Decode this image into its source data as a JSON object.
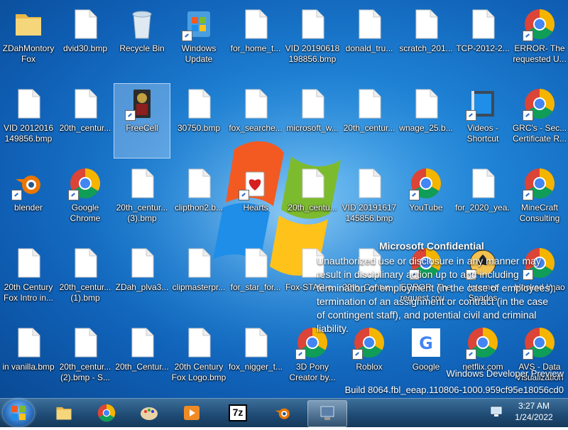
{
  "desktop": {
    "icons": [
      {
        "label": "ZDahMontory Fox",
        "icon": "folder-icon"
      },
      {
        "label": "dvid30.bmp",
        "icon": "bmp-file-icon"
      },
      {
        "label": "Recycle Bin",
        "icon": "recycle-bin-icon"
      },
      {
        "label": "Windows Update",
        "icon": "windows-update-icon"
      },
      {
        "label": "for_home_t...",
        "icon": "bmp-file-icon"
      },
      {
        "label": "VID 20190618 198856.bmp",
        "icon": "bmp-file-icon"
      },
      {
        "label": "donald_tru...",
        "icon": "bmp-file-icon"
      },
      {
        "label": "scratch_201...",
        "icon": "bmp-file-icon"
      },
      {
        "label": "TCP-2012-2...",
        "icon": "bmp-file-icon"
      },
      {
        "label": "ERROR- The requested U...",
        "icon": "chrome-icon"
      },
      {
        "label": "VID 2012016 149856.bmp",
        "icon": "bmp-file-icon"
      },
      {
        "label": "20th_centur...",
        "icon": "bmp-file-icon"
      },
      {
        "label": "FreeCell",
        "icon": "freecell-icon"
      },
      {
        "label": "30750.bmp",
        "icon": "bmp-file-icon"
      },
      {
        "label": "fox_searche...",
        "icon": "bmp-file-icon"
      },
      {
        "label": "microsoft_w...",
        "icon": "bmp-file-icon"
      },
      {
        "label": "20th_centur...",
        "icon": "bmp-file-icon"
      },
      {
        "label": "wnage_25.b...",
        "icon": "bmp-file-icon"
      },
      {
        "label": "Videos - Shortcut",
        "icon": "videos-icon"
      },
      {
        "label": "GRC's - Sec... Certificate R...",
        "icon": "chrome-icon"
      },
      {
        "label": "blender",
        "icon": "blender-icon"
      },
      {
        "label": "Google Chrome",
        "icon": "chrome-icon"
      },
      {
        "label": "20th_centur... (3).bmp",
        "icon": "bmp-file-icon"
      },
      {
        "label": "clipthon2.b...",
        "icon": "bmp-file-icon"
      },
      {
        "label": "Hearts",
        "icon": "hearts-icon"
      },
      {
        "label": "20th_centu...",
        "icon": "bmp-file-icon"
      },
      {
        "label": "VID 20191617 145856.bmp",
        "icon": "bmp-file-icon"
      },
      {
        "label": "YouTube",
        "icon": "chrome-icon"
      },
      {
        "label": "for_2020_yea...",
        "icon": "bmp-file-icon"
      },
      {
        "label": "MineCraft Consulting",
        "icon": "chrome-icon"
      },
      {
        "label": "20th Century Fox Intro in...",
        "icon": "bmp-file-icon"
      },
      {
        "label": "20th_centur... (1).bmp",
        "icon": "bmp-file-icon"
      },
      {
        "label": "ZDah_plva3...",
        "icon": "bmp-file-icon"
      },
      {
        "label": "clipmasterpr...",
        "icon": "bmp-file-icon"
      },
      {
        "label": "for_star_for...",
        "icon": "bmp-file-icon"
      },
      {
        "label": "Fox-STAR-o...",
        "icon": "bmp-file-icon"
      },
      {
        "label": "20th_Centur...",
        "icon": "bmp-file-icon"
      },
      {
        "label": "ERROR- The request cou...",
        "icon": "chrome-icon"
      },
      {
        "label": "Internet Spades",
        "icon": "spades-icon"
      },
      {
        "label": "blocked Imao",
        "icon": "chrome-icon"
      },
      {
        "label": "in vanilla.bmp",
        "icon": "bmp-file-icon"
      },
      {
        "label": "20th_centur... (2).bmp - S...",
        "icon": "bmp-file-icon"
      },
      {
        "label": "20th_Centur...",
        "icon": "bmp-file-icon"
      },
      {
        "label": "20th Century Fox Logo.bmp",
        "icon": "bmp-file-icon"
      },
      {
        "label": "fox_nigger_t...",
        "icon": "bmp-file-icon"
      },
      {
        "label": "3D Pony Creator by...",
        "icon": "chrome-icon"
      },
      {
        "label": "Roblox",
        "icon": "chrome-icon"
      },
      {
        "label": "Google",
        "icon": "google-icon"
      },
      {
        "label": "netflix.com",
        "icon": "chrome-icon"
      },
      {
        "label": "AVS - Data Visualization",
        "icon": "chrome-icon"
      }
    ]
  },
  "watermark": {
    "title": "Microsoft Confidential",
    "body": "Unauthorized use or disclosure in any manner may result in disciplinary action up to and including termination of employment (in the case of employees), termination of an assignment or contract (in the case of contingent staff), and potential civil and criminal liability.",
    "build_line1": "Windows Developer Preview",
    "build_line2": "Build 8064.fbl_eeap.110806-1000.959cf95e18056cd0"
  },
  "taskbar": {
    "start_icon": "windows-start-orb-icon",
    "pinned": [
      {
        "name": "file-explorer",
        "icon": "folder-icon"
      },
      {
        "name": "chrome",
        "icon": "chrome-icon"
      },
      {
        "name": "paint",
        "icon": "paint-icon"
      },
      {
        "name": "media-player",
        "icon": "media-icon"
      },
      {
        "name": "7zip",
        "icon": "7zip-icon",
        "text": "7z"
      },
      {
        "name": "blender",
        "icon": "blender-icon"
      },
      {
        "name": "network-app",
        "icon": "network-icon"
      }
    ],
    "clock_time": "3:27 AM",
    "clock_date": "1/24/2022"
  },
  "colors": {
    "desktop_blue": "#1d7fd2",
    "taskbar": "#1e4a73"
  }
}
